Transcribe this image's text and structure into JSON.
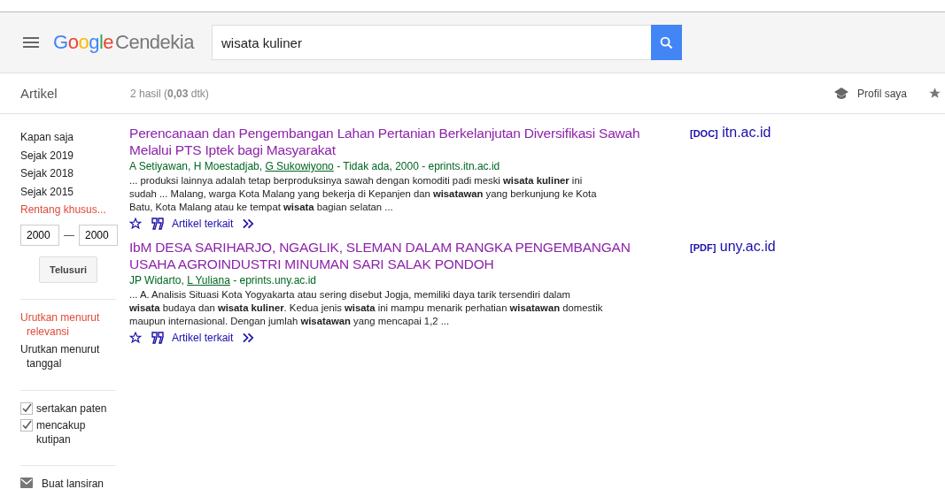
{
  "header": {
    "logo": {
      "brand": "Google",
      "product": "Cendekia"
    },
    "search": {
      "value": "wisata kuliner"
    }
  },
  "subbar": {
    "section": "Artikel",
    "stats": "2 hasil (**0,03** dtk)",
    "profile": "Profil saya"
  },
  "sidebar": {
    "time_filters": [
      {
        "label": "Kapan saja",
        "selected": false
      },
      {
        "label": "Sejak 2019",
        "selected": false
      },
      {
        "label": "Sejak 2018",
        "selected": false
      },
      {
        "label": "Sejak 2015",
        "selected": false
      },
      {
        "label": "Rentang khusus...",
        "selected": true
      }
    ],
    "range_from": "2000",
    "range_separator": "—",
    "range_to": "2000",
    "search_button": "Telusuri",
    "sort": [
      {
        "label": "Urutkan menurut relevansi",
        "selected": true
      },
      {
        "label": "Urutkan menurut tanggal",
        "selected": false
      }
    ],
    "options": [
      {
        "label": "sertakan paten",
        "checked": true
      },
      {
        "label": "mencakup kutipan",
        "checked": true
      }
    ],
    "alert": "Buat lansiran"
  },
  "results": [
    {
      "title": "Perencanaan dan Pengembangan Lahan Pertanian Berkelanjutan Diversifikasi Sawah Melalui PTS Iptek bagi Masyarakat",
      "authors": [
        {
          "text": "A Setiyawan, H Moestadjab, ",
          "linked": false
        },
        {
          "text": "G Sukowiyono",
          "linked": true
        },
        {
          "text": " - Tidak ada, 2000 - eprints.itn.ac.id",
          "linked": false
        }
      ],
      "snippet": "... produksi lainnya adalah tetap berproduksinya sawah dengan komoditi padi meski **wisata kuliner** ini sudah ... Malang, warga Kota Malang yang bekerja di Kepanjen dan **wisatawan** yang berkunjung ke Kota Batu, Kota Malang atau ke tempat **wisata** bagian selatan ...",
      "related": "Artikel terkait",
      "file_type": "[DOC]",
      "file_host": "itn.ac.id"
    },
    {
      "title": "IbM DESA SARIHARJO, NGAGLIK, SLEMAN DALAM RANGKA PENGEMBANGAN USAHA AGROINDUSTRI MINUMAN SARI SALAK PONDOH",
      "authors": [
        {
          "text": "JP Widarto, ",
          "linked": false
        },
        {
          "text": "L Yuliana",
          "linked": true
        },
        {
          "text": " - eprints.uny.ac.id",
          "linked": false
        }
      ],
      "snippet": "... A. Analisis Situasi Kota Yogyakarta atau sering disebut Jogja, memiliki daya tarik tersendiri dalam **wisata** budaya dan **wisata kuliner**. Kedua jenis **wisata** ini mampu menarik perhatian **wisatawan** domestik maupun internasional. Dengan jumlah **wisatawan** yang mencapai 1,2 ...",
      "related": "Artikel terkait",
      "file_type": "[PDF]",
      "file_host": "uny.ac.id"
    }
  ]
}
